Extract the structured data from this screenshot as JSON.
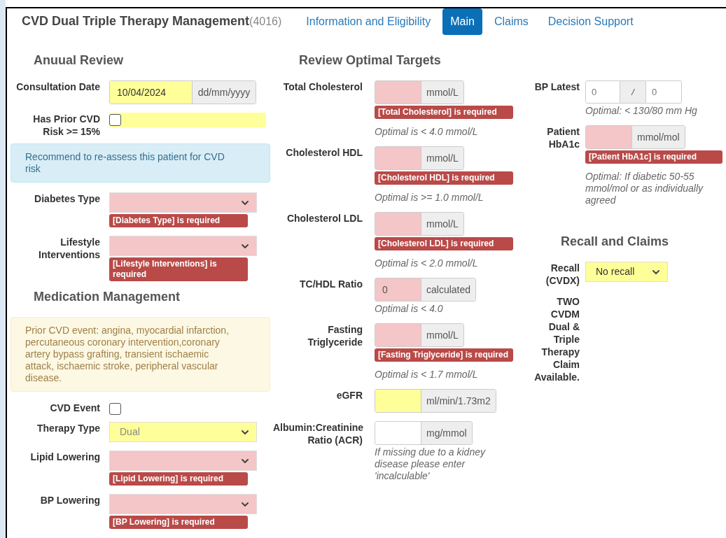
{
  "header": {
    "title": "CVD Dual Triple Therapy Management",
    "code": "(4016)",
    "tabs": [
      {
        "label": "Information and Eligibility",
        "selected": false
      },
      {
        "label": "Main",
        "selected": true
      },
      {
        "label": "Claims",
        "selected": false
      },
      {
        "label": "Decision Support",
        "selected": false
      }
    ]
  },
  "columns": [
    [
      {
        "kind": "heading",
        "text": "Anuual Review"
      },
      {
        "kind": "date",
        "label": "Consultation Date",
        "value": "10/04/2024",
        "addon": "dd/mm/yyyy",
        "invalid": false,
        "highlighted": true
      },
      {
        "kind": "checkbox",
        "label": "Has Prior CVD Risk >= 15%",
        "checked": false,
        "highlighted": true
      },
      {
        "kind": "info_alert",
        "text": "Recommend to re-assess this patient for CVD risk"
      },
      {
        "kind": "select",
        "label": "Diabetes Type",
        "invalid": true,
        "disabled": false,
        "error": "[Diabetes Type] is required"
      },
      {
        "kind": "select",
        "label": "Lifestyle Interventions",
        "invalid": true,
        "disabled": false,
        "error": "[Lifestyle Interventions] is required"
      },
      {
        "kind": "heading",
        "text": "Medication Management"
      },
      {
        "kind": "warning_alert",
        "text": "Prior CVD event: angina, myocardial infarction, percutaneous coronary intervention,coronary artery bypass grafting, transient ischaemic attack, ischaemic stroke, peripheral vascular disease."
      },
      {
        "kind": "checkbox",
        "label": "CVD Event",
        "checked": false,
        "highlighted": false
      },
      {
        "kind": "select",
        "label": "Therapy Type",
        "value": "Dual",
        "invalid": false,
        "highlighted": true,
        "disabled": true
      },
      {
        "kind": "select",
        "label": "Lipid Lowering",
        "invalid": true,
        "disabled": false,
        "error": "[Lipid Lowering] is required"
      },
      {
        "kind": "select",
        "label": "BP Lowering",
        "invalid": true,
        "disabled": false,
        "error": "[BP Lowering] is required"
      }
    ],
    [
      {
        "kind": "heading",
        "text": "Review Optimal Targets"
      },
      {
        "kind": "unit",
        "label": "Total Cholesterol",
        "unit": "mmol/L",
        "invalid": true,
        "error": "[Total Cholesterol] is required",
        "hint": "Optimal is < 4.0 mmol/L"
      },
      {
        "kind": "unit",
        "label": "Cholesterol HDL",
        "unit": "mmol/L",
        "invalid": true,
        "error": "[Cholesterol HDL] is required",
        "hint": "Optimal is >= 1.0 mmol/L"
      },
      {
        "kind": "unit",
        "label": "Cholesterol LDL",
        "unit": "mmol/L",
        "invalid": true,
        "error": "[Cholesterol LDL] is required",
        "hint": "Optimal is < 2.0 mmol/L"
      },
      {
        "kind": "unit",
        "label": "TC/HDL Ratio",
        "value": "0",
        "unit": "calculated",
        "invalid": true,
        "hint": "Optimal is < 4.0"
      },
      {
        "kind": "unit",
        "label": "Fasting Triglyceride",
        "unit": "mmol/L",
        "invalid": true,
        "error": "[Fasting Triglyceride] is required",
        "hint": "Optimal is < 1.7 mmol/L"
      },
      {
        "kind": "unit",
        "label": "eGFR",
        "unit": "ml/min/1.73m2",
        "invalid": false,
        "highlighted": true
      },
      {
        "kind": "unit",
        "label": "Albumin:Creatinine Ratio (ACR)",
        "unit": "mg/mmol",
        "invalid": false,
        "highlighted": false,
        "hint": "If missing due to a kidney disease please enter 'incalculable'"
      }
    ],
    [
      {
        "kind": "bp",
        "label": "BP Latest",
        "systolic": "0",
        "separator": "/",
        "diastolic": "0",
        "hint": "Optimal: < 130/80 mm Hg"
      },
      {
        "kind": "unit",
        "label": "Patient HbA1c",
        "unit": "mmol/mol",
        "invalid": true,
        "error": "[Patient HbA1c] is required",
        "hint": "Optimal: If diabetic 50-55 mmol/mol or as individually agreed"
      },
      {
        "kind": "heading",
        "text": "Recall and Claims"
      },
      {
        "kind": "select",
        "label": "Recall (CVDX)",
        "value": "No recall",
        "invalid": false,
        "highlighted": true,
        "disabled": false
      },
      {
        "kind": "note",
        "label": "TWO CVDM Dual & Triple Therapy Claim Available."
      }
    ]
  ]
}
